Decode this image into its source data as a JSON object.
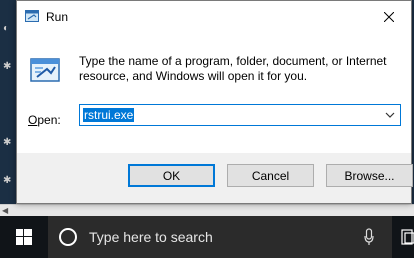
{
  "dialog": {
    "title": "Run",
    "description": "Type the name of a program, folder, document, or Internet resource, and Windows will open it for you.",
    "open_label_prefix": "",
    "open_label_u": "O",
    "open_label_rest": "pen:",
    "open_value": "rstrui.exe",
    "ok_label": "OK",
    "cancel_label": "Cancel",
    "browse_label": "Browse..."
  },
  "taskbar": {
    "search_placeholder": "Type here to search"
  },
  "colors": {
    "accent": "#0078d7",
    "taskbar": "#101418",
    "search_box": "#2b2b2b"
  }
}
